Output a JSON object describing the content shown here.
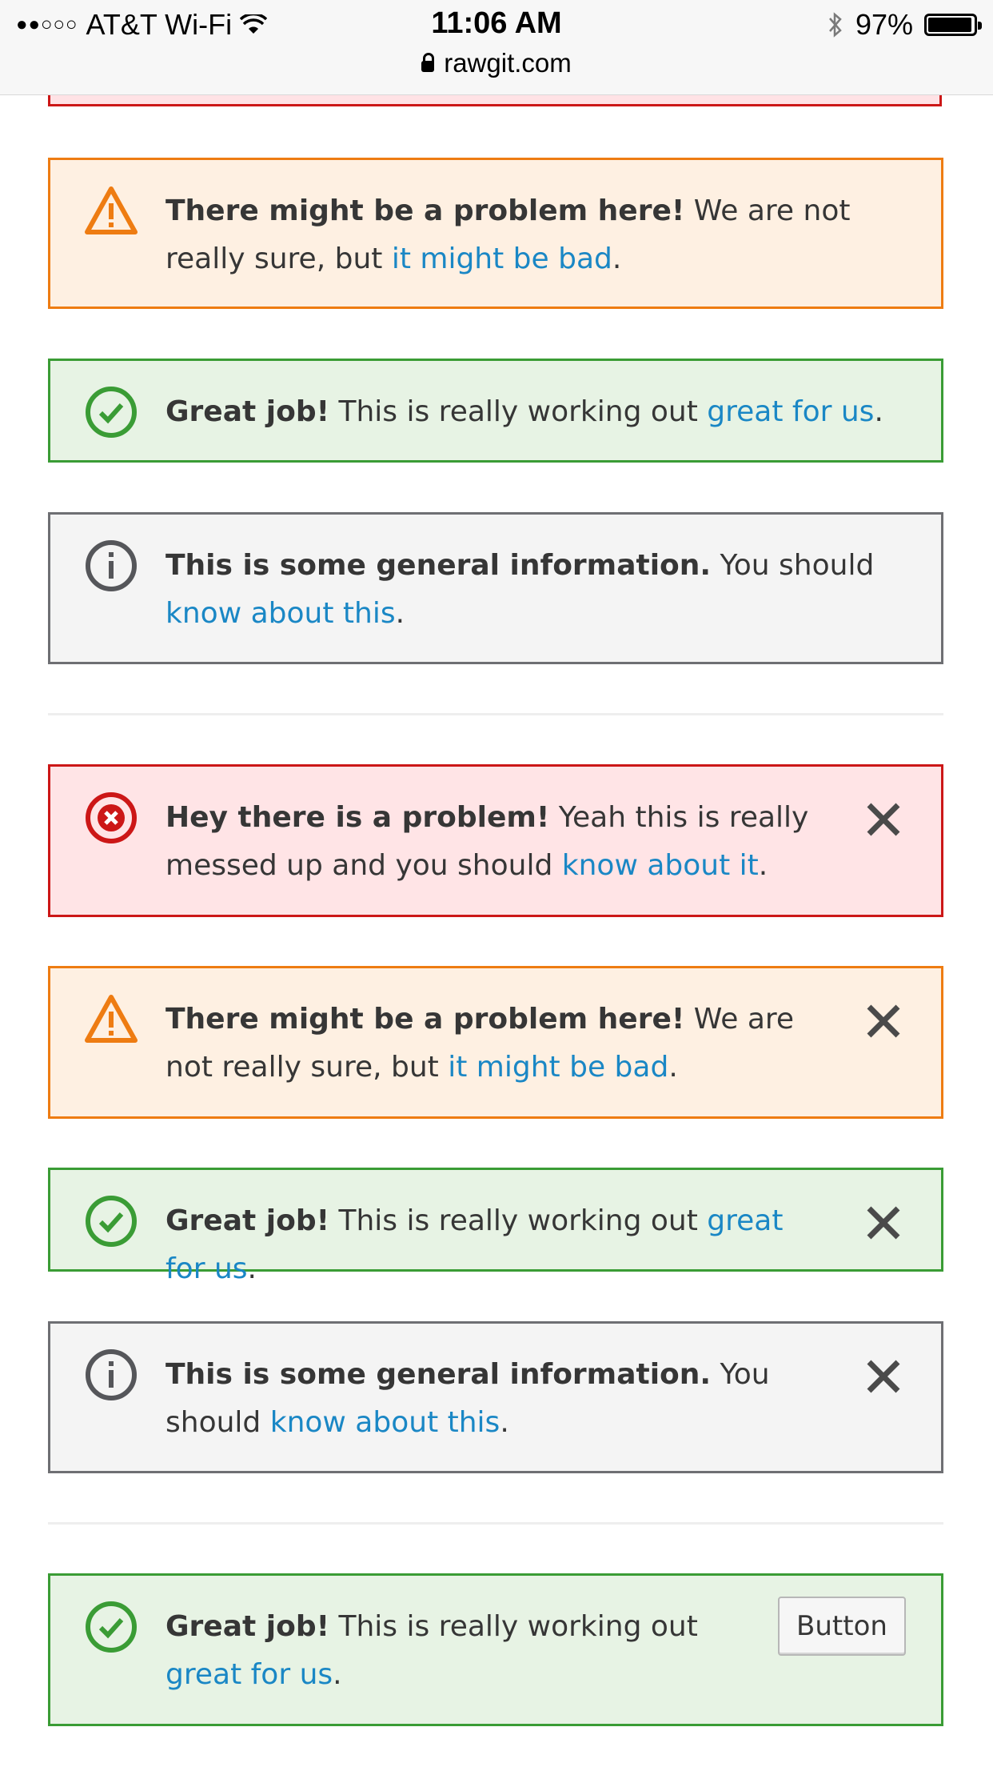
{
  "status_bar": {
    "signal": "●●○○○",
    "carrier": "AT&T Wi-Fi",
    "time": "11:06 AM",
    "battery": "97%",
    "battery_level": 0.97,
    "url": "rawgit.com"
  },
  "colors": {
    "error": "#cc1717",
    "warning": "#ee7c12",
    "success": "#3a9c35",
    "info": "#6e6f73",
    "link": "#1a87c5"
  },
  "alerts": [
    {
      "type": "warning",
      "title": "There might be a problem here!",
      "body": "We are not really sure, but",
      "link": "it might be bad",
      "end": "."
    },
    {
      "type": "success",
      "title": "Great job!",
      "body": "This is really working out",
      "link": "great for us",
      "end": "."
    },
    {
      "type": "info",
      "title": "This is some general information.",
      "body": "You should",
      "link": "know about this",
      "end": "."
    }
  ],
  "dismissible_alerts": [
    {
      "type": "error",
      "title": "Hey there is a problem!",
      "body": "Yeah this is really messed up and you should",
      "link": "know about it",
      "end": "."
    },
    {
      "type": "warning",
      "title": "There might be a problem here!",
      "body": "We are not really sure, but",
      "link": "it might be bad",
      "end": "."
    },
    {
      "type": "success",
      "title": "Great job!",
      "body": "This is really working out",
      "link": "great for us",
      "end": "."
    },
    {
      "type": "info",
      "title": "This is some general information.",
      "body": "You should",
      "link": "know about this",
      "end": "."
    }
  ],
  "button_alert": {
    "type": "success",
    "title": "Great job!",
    "body": "This is really working out",
    "link": "great for us",
    "end": ".",
    "button_label": "Button"
  }
}
